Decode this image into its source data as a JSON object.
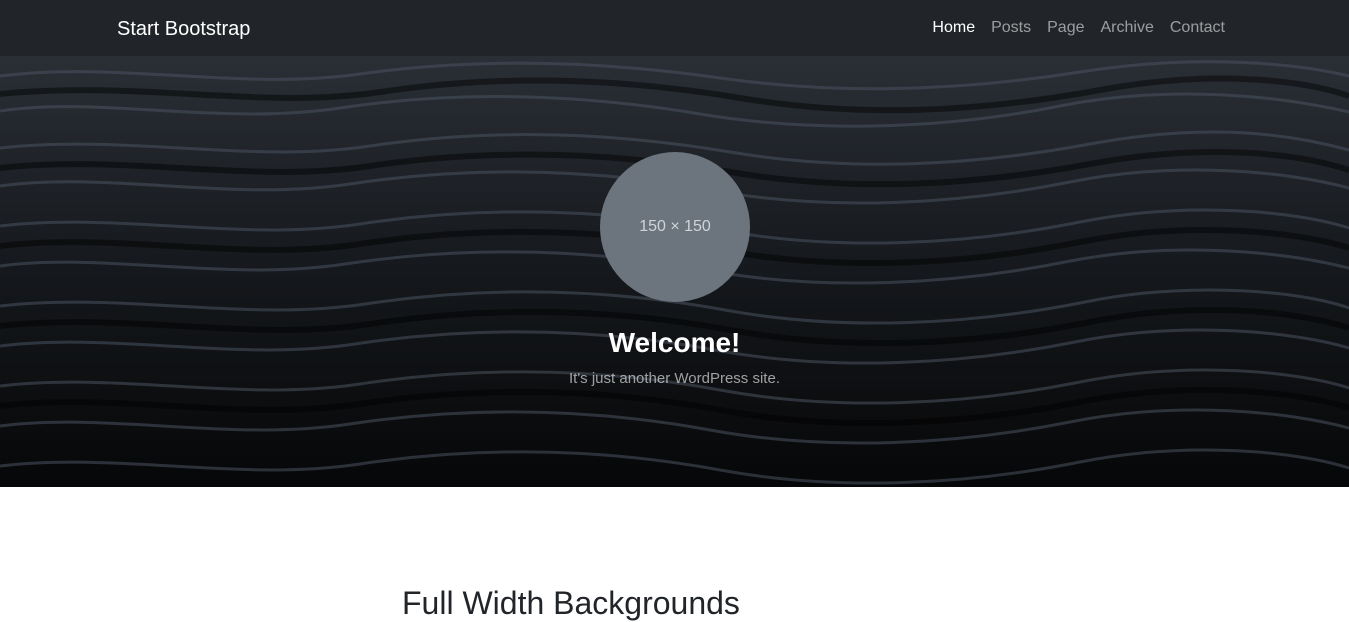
{
  "navbar": {
    "brand": "Start Bootstrap",
    "links": [
      {
        "label": "Home",
        "active": true
      },
      {
        "label": "Posts",
        "active": false
      },
      {
        "label": "Page",
        "active": false
      },
      {
        "label": "Archive",
        "active": false
      },
      {
        "label": "Contact",
        "active": false
      }
    ]
  },
  "hero": {
    "avatar_placeholder": "150 × 150",
    "heading": "Welcome!",
    "tagline": "It's just another WordPress site."
  },
  "content": {
    "section_title": "Full Width Backgrounds"
  },
  "colors": {
    "navbar_bg": "#212529",
    "avatar_bg": "#6c757d",
    "hero_bg": "#0b0d10"
  }
}
